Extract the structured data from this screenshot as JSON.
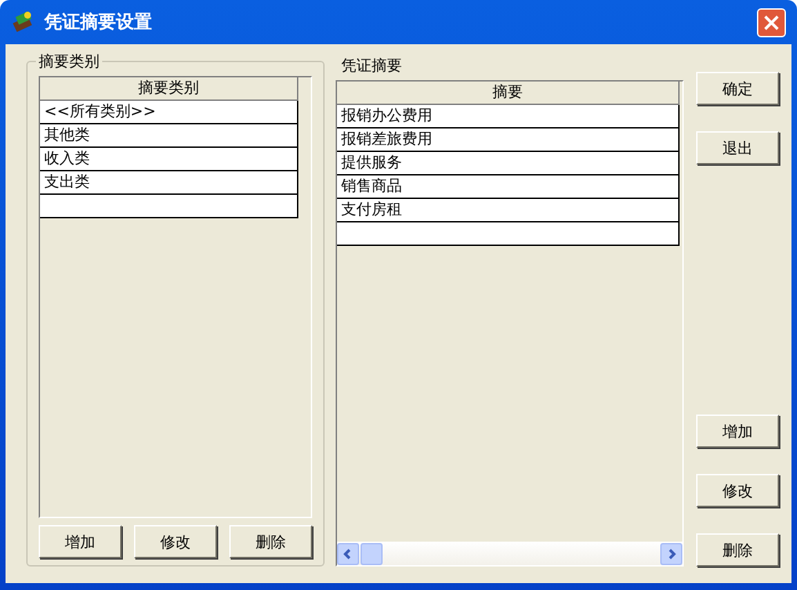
{
  "window": {
    "title": "凭证摘要设置"
  },
  "category_group": {
    "legend": "摘要类别",
    "table": {
      "columns": [
        "摘要类别"
      ],
      "rows": [
        {
          "cells": [
            "<<所有类别>>"
          ]
        },
        {
          "cells": [
            "其他类"
          ]
        },
        {
          "cells": [
            "收入类"
          ]
        },
        {
          "cells": [
            "支出类"
          ]
        }
      ]
    },
    "buttons": [
      "增加",
      "修改",
      "删除"
    ]
  },
  "summary_panel": {
    "label": "凭证摘要",
    "table": {
      "columns": [
        "摘要"
      ],
      "rows": [
        {
          "cells": [
            "报销办公费用"
          ]
        },
        {
          "cells": [
            "报销差旅费用"
          ]
        },
        {
          "cells": [
            "提供服务"
          ]
        },
        {
          "cells": [
            "销售商品"
          ]
        },
        {
          "cells": [
            "支付房租"
          ]
        }
      ]
    }
  },
  "side_buttons_top": [
    "确定",
    "退出"
  ],
  "side_buttons_bottom": [
    "增加",
    "修改",
    "删除"
  ]
}
